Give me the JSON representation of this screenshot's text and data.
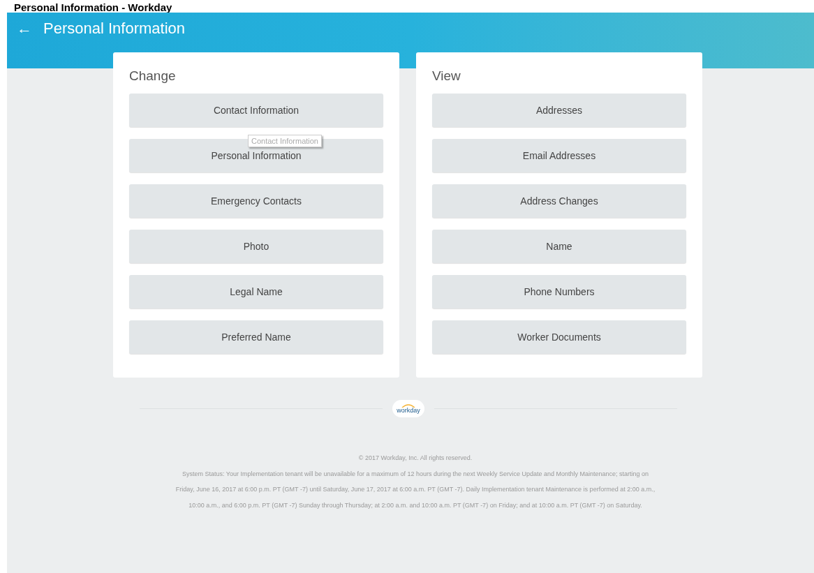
{
  "document_title": "Personal Information - Workday",
  "header": {
    "back": "←",
    "title": "Personal Information"
  },
  "panels": [
    {
      "title": "Change",
      "buttons": [
        "Contact Information",
        "Personal Information",
        "Emergency Contacts",
        "Photo",
        "Legal Name",
        "Preferred Name"
      ]
    },
    {
      "title": "View",
      "buttons": [
        "Addresses",
        "Email Addresses",
        "Address Changes",
        "Name",
        "Phone Numbers",
        "Worker Documents"
      ]
    }
  ],
  "tooltip": {
    "text": "Contact Information"
  },
  "footer": {
    "logo": "workday",
    "copyright": "© 2017 Workday, Inc. All rights reserved.",
    "status": "System Status: Your Implementation tenant will be unavailable for a maximum of 12 hours during the next Weekly Service Update and Monthly Maintenance; starting on Friday, June 16, 2017 at 6:00 p.m. PT (GMT -7) until Saturday, June 17, 2017 at 6:00 a.m. PT (GMT -7). Daily Implementation tenant Maintenance is performed at 2:00 a.m., 10:00 a.m., and 6:00 p.m. PT (GMT -7) Sunday through Thursday; at 2:00 a.m. and 10:00 a.m. PT (GMT -7) on Friday; and at 10:00 a.m. PT (GMT -7) on Saturday."
  }
}
